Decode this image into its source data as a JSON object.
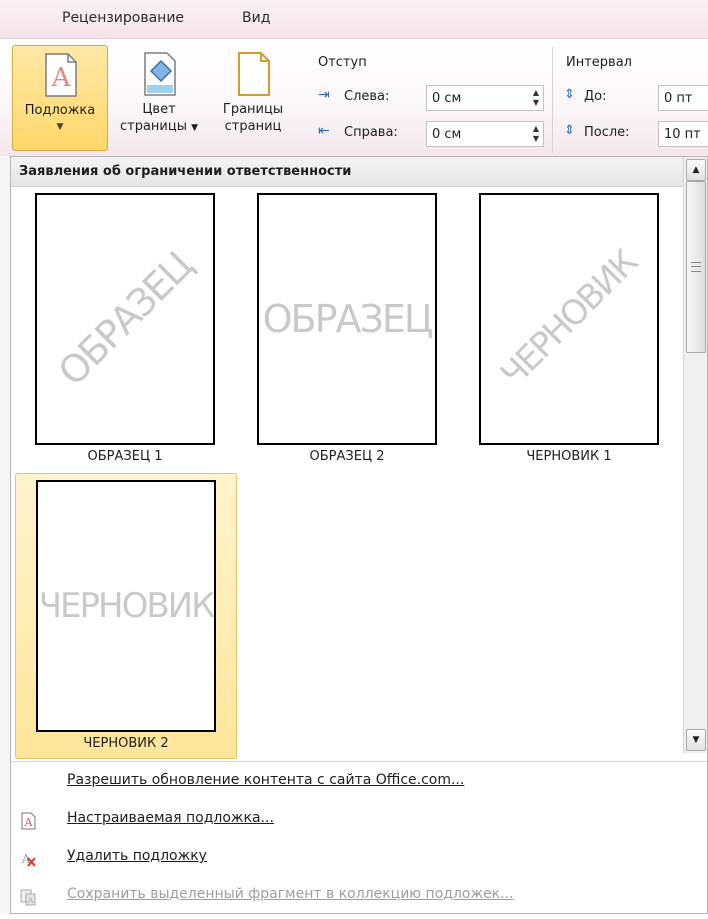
{
  "tabs": [
    {
      "label": "Рецензирование"
    },
    {
      "label": "Вид"
    }
  ],
  "ribbon": {
    "watermark_btn": {
      "label": "Подложка"
    },
    "page_color_btn": {
      "line1": "Цвет",
      "line2": "страницы"
    },
    "page_borders_btn": {
      "line1": "Границы",
      "line2": "страниц"
    },
    "indent": {
      "title": "Отступ",
      "left_label": "Слева:",
      "left_value": "0 см",
      "right_label": "Справа:",
      "right_value": "0 см"
    },
    "spacing": {
      "title": "Интервал",
      "before_label": "До:",
      "before_value": "0 пт",
      "after_label": "После:",
      "after_value": "10 пт"
    }
  },
  "gallery": {
    "header": "Заявления об ограничении ответственности",
    "items": [
      {
        "caption": "ОБРАЗЕЦ 1",
        "watermark_text": "ОБРАЗЕЦ",
        "orientation": "diagonal",
        "selected": false
      },
      {
        "caption": "ОБРАЗЕЦ 2",
        "watermark_text": "ОБРАЗЕЦ",
        "orientation": "horizontal",
        "selected": false
      },
      {
        "caption": "ЧЕРНОВИК 1",
        "watermark_text": "ЧЕРНОВИК",
        "orientation": "diagonal",
        "selected": false
      },
      {
        "caption": "ЧЕРНОВИК 2",
        "watermark_text": "ЧЕРНОВИК",
        "orientation": "horizontal",
        "selected": true
      }
    ]
  },
  "menu": [
    {
      "label": "Разрешить обновление контента с сайта Office.com...",
      "icon": "",
      "disabled": false
    },
    {
      "label": "Настраиваемая подложка...",
      "icon": "custom-watermark-icon",
      "disabled": false
    },
    {
      "label": "Удалить подложку",
      "icon": "remove-watermark-icon",
      "disabled": false
    },
    {
      "label": "Сохранить выделенный фрагмент в коллекцию подложек...",
      "icon": "save-to-gallery-icon",
      "disabled": true
    }
  ],
  "colors": {
    "accent_selected": "#ffd76a",
    "tab_strip": "#f4e3e9",
    "watermark_gray": "#c9c9c9"
  }
}
